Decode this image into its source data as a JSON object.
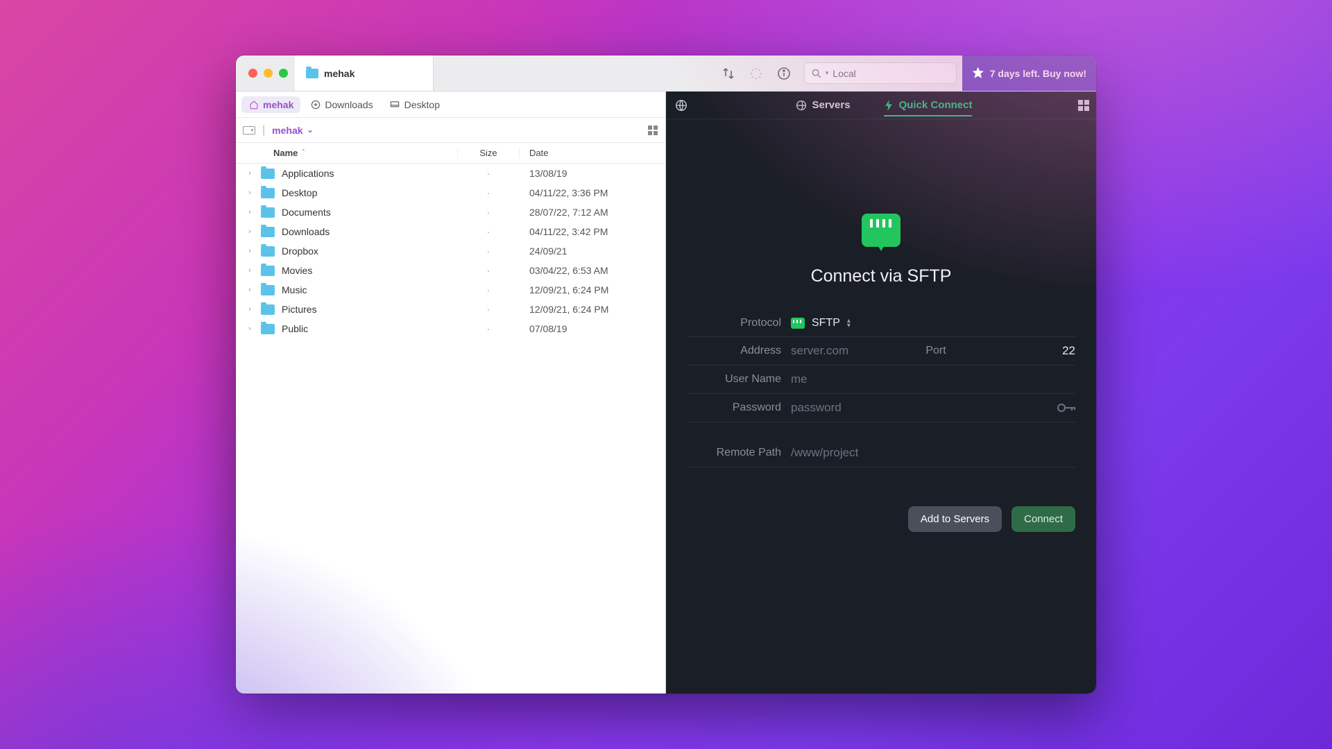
{
  "window": {
    "tab_title": "mehak"
  },
  "toolbar": {
    "search_placeholder": "Local",
    "trial_text": "7 days left. Buy now!"
  },
  "favorites": [
    {
      "icon": "home",
      "label": "mehak",
      "active": true
    },
    {
      "icon": "download",
      "label": "Downloads",
      "active": false
    },
    {
      "icon": "desktop",
      "label": "Desktop",
      "active": false
    }
  ],
  "breadcrumb": {
    "current": "mehak"
  },
  "columns": {
    "name": "Name",
    "size": "Size",
    "date": "Date"
  },
  "files": [
    {
      "name": "Applications",
      "size": "·",
      "date": "13/08/19"
    },
    {
      "name": "Desktop",
      "size": "·",
      "date": "04/11/22, 3:36 PM"
    },
    {
      "name": "Documents",
      "size": "·",
      "date": "28/07/22, 7:12 AM"
    },
    {
      "name": "Downloads",
      "size": "·",
      "date": "04/11/22, 3:42 PM"
    },
    {
      "name": "Dropbox",
      "size": "·",
      "date": "24/09/21"
    },
    {
      "name": "Movies",
      "size": "·",
      "date": "03/04/22, 6:53 AM"
    },
    {
      "name": "Music",
      "size": "·",
      "date": "12/09/21, 6:24 PM"
    },
    {
      "name": "Pictures",
      "size": "·",
      "date": "12/09/21, 6:24 PM"
    },
    {
      "name": "Public",
      "size": "·",
      "date": "07/08/19"
    }
  ],
  "remote": {
    "tab_servers": "Servers",
    "tab_quick": "Quick Connect",
    "title": "Connect via SFTP",
    "labels": {
      "protocol": "Protocol",
      "address": "Address",
      "port": "Port",
      "username": "User Name",
      "password": "Password",
      "remote_path": "Remote Path"
    },
    "values": {
      "protocol": "SFTP",
      "address_placeholder": "server.com",
      "port": "22",
      "username_placeholder": "me",
      "password_placeholder": "password",
      "remote_path_placeholder": "/www/project"
    },
    "buttons": {
      "add": "Add to Servers",
      "connect": "Connect"
    }
  }
}
